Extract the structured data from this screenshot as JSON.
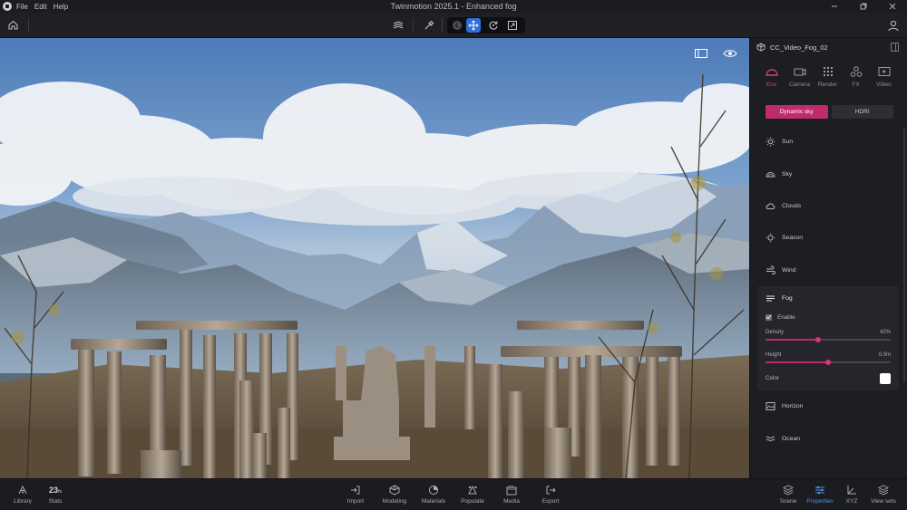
{
  "menu": {
    "items": [
      "File",
      "Edit",
      "Help"
    ],
    "window_title": "Twinmotion 2025.1 - Enhanced fog"
  },
  "toolbar": {
    "icons": [
      "home-icon",
      "layers-icon",
      "eyedropper-icon",
      "back-icon",
      "move-icon",
      "rotate-icon",
      "scale-icon",
      "user-icon"
    ],
    "active_tool": "move"
  },
  "panel": {
    "object_name": "CC_Video_Fog_02",
    "tabs": [
      {
        "label": "Env",
        "active": true
      },
      {
        "label": "Camera",
        "active": false
      },
      {
        "label": "Render",
        "active": false
      },
      {
        "label": "FX",
        "active": false
      },
      {
        "label": "Video",
        "active": false
      }
    ],
    "sky_modes": [
      {
        "label": "Dynamic sky",
        "active": true
      },
      {
        "label": "HDRI",
        "active": false
      }
    ],
    "sections_top": [
      "Sun",
      "Sky",
      "Clouds",
      "Season",
      "Wind"
    ],
    "fog": {
      "label": "Fog",
      "enable_label": "Enable",
      "enabled": true,
      "density_label": "Density",
      "density_value": "42%",
      "density_fraction": 0.42,
      "height_label": "Height",
      "height_value": "0.0m",
      "height_fraction": 0.5,
      "color_label": "Color",
      "color": "#ffffff"
    },
    "sections_bottom": [
      "Horizon",
      "Ocean"
    ]
  },
  "bottom": {
    "left": [
      {
        "label": "Library",
        "icon": "library-icon"
      },
      {
        "label": "Stats",
        "value": "23",
        "unit": "fs",
        "icon": "stats-icon"
      }
    ],
    "center": [
      {
        "label": "Import",
        "icon": "import-icon"
      },
      {
        "label": "Modeling",
        "icon": "modeling-icon"
      },
      {
        "label": "Materials",
        "icon": "materials-icon"
      },
      {
        "label": "Populate",
        "icon": "populate-icon"
      },
      {
        "label": "Media",
        "icon": "media-icon"
      },
      {
        "label": "Export",
        "icon": "export-icon"
      }
    ],
    "right": [
      {
        "label": "Scene",
        "icon": "scene-icon",
        "active": false
      },
      {
        "label": "Properties",
        "icon": "properties-icon",
        "active": true
      },
      {
        "label": "XYZ",
        "icon": "xyz-icon",
        "active": false
      },
      {
        "label": "View sets",
        "icon": "view-sets-icon",
        "active": false
      }
    ]
  },
  "colors": {
    "accent_pink": "#c02c6a",
    "accent_blue": "#2f6fd6"
  }
}
